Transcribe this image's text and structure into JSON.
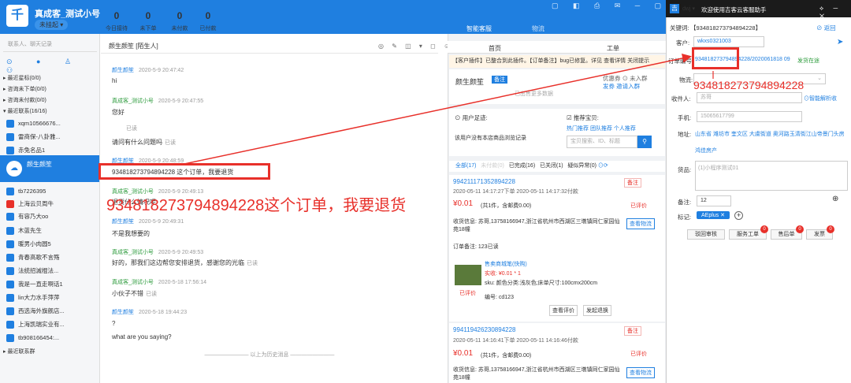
{
  "topbar": {
    "shop_name": "真成客_测试小号",
    "shop_status": "未挂起 ▾",
    "stats": [
      {
        "n": "0",
        "l": "今日接待"
      },
      {
        "n": "0",
        "l": "未下单"
      },
      {
        "n": "0",
        "l": "未付款"
      },
      {
        "n": "0",
        "l": "已付款"
      }
    ],
    "window_controls": "▢ ◧ ⎙ ✉ ─ ▢ ✕",
    "tab_smart": "智能客服",
    "tab_logistics": "物流"
  },
  "left": {
    "search_placeholder": "联系人、聊天记录",
    "filters": "⊙ ● ♙ ⚇",
    "groups": [
      "▸ 最近星标(0/0)",
      "▸ 咨询未下单(0/0)",
      "▸ 咨询未付款(0/0)",
      "▾ 最近联系(16/16)"
    ],
    "contacts": [
      "xqm10566676...",
      "雷商保-八卦雅...",
      "赤兔名品1",
      "颜生颜笙",
      "tb7226395",
      "上海云贝周牛",
      "有容乃大oo",
      "木蓝先生",
      "暖男小肉圆5",
      "青春高歌不言殇",
      "法统招滅棍法...",
      "我是一直走啊话1",
      "lin大力水手萍萍",
      "西选海外旗舰店...",
      "上海凯瑞实业有...",
      "tb908166454:..."
    ],
    "footer_group": "▸ 最近联系群"
  },
  "chat": {
    "header": "颜生颜笙 [陌生人]",
    "tools": "◎ ✎ ◫ ▾ ◻ ☺",
    "messages": [
      {
        "who": "颜生颜笙",
        "time": "2020-5-9 20:47:42",
        "text": "hi",
        "read": ""
      },
      {
        "who": "真成客_测试小号",
        "time": "2020-5-9 20:47:55",
        "text": "您好",
        "read": ""
      },
      {
        "who": "",
        "time": "",
        "text": "已读",
        "read": ""
      },
      {
        "who": "",
        "time": "",
        "text": "请问有什么问题吗",
        "read": "已读"
      },
      {
        "who": "颜生颜笙",
        "time": "2020-5-9 20:48:59",
        "text": "934818273794894228 这个订单，我要退货",
        "read": ""
      },
      {
        "who": "真成客_测试小号",
        "time": "2020-5-9 20:49:13",
        "text": "退货什么情况呢",
        "read": ""
      },
      {
        "who": "颜生颜笙",
        "time": "2020-5-9 20:49:31",
        "text": "不是我想要的",
        "read": ""
      },
      {
        "who": "真成客_测试小号",
        "time": "2020-5-9 20:49:53",
        "text": "好的，那我们这边帮您安排退货，感谢您的光临",
        "read": "已读"
      },
      {
        "who": "真成客_测试小号",
        "time": "2020-5-18 17:56:14",
        "text": "小伙子不错",
        "read": "已读"
      },
      {
        "who": "颜生颜笙",
        "time": "2020-5-18 19:44:23",
        "text": "?",
        "read": ""
      },
      {
        "who": "",
        "time": "",
        "text": "what are you saying?",
        "read": ""
      }
    ],
    "history": "———————— 以上为历史消息 ————————",
    "big_annotation": "934818273794894228这个订单，我要退货"
  },
  "orders": {
    "tab_home": "首页",
    "tab_work": "工单",
    "notice": "【客户插件】已整合到此插件。【订单备注】bug已修复。详见 查看详情 关闭提示",
    "customer_name": "颜生颜笙",
    "customer_badge": "备注",
    "customer_right1": "优惠券 ⊙  未入群",
    "customer_right2": "发券      邀请入群",
    "customer_hint": "已出售更多数据",
    "track_title": "⊙ 用户足迹:",
    "track_text": "该用户没有本店商品浏览记录",
    "rec_title": "☑ 推荐宝贝:",
    "rec_links": "热门推荐  团队推荐  个人推荐",
    "rec_placeholder": "宝贝搜索、ID、标题",
    "order_tabs": [
      "全部(17)",
      "未付款(0)",
      "已完成(16)",
      "已关闭(1)",
      "疑似异常(0)"
    ],
    "order1": {
      "id": "994211171352894228",
      "time": "2020-05-11 14:17:27下单 2020-05-11 14:17:32付款",
      "price": "¥0.01",
      "price_note": "(共1件，含邮费0.00)",
      "status": "已评价",
      "addr": "收货信息: 苏哥,13758166947,浙江省杭州市西湖区三墩镇同仁家园仙苑18幢",
      "btn_logistics": "查看物流",
      "remark": "订单备注: 123已读",
      "goods_title": "售卖商城笔(快购)",
      "goods_price": "实收: ¥0.01 * 1",
      "goods_sku": "sku: 颜色分类:浅灰色;床单尺寸:100cmx200cm",
      "goods_code": "编号: cd123",
      "goods_status": "已评价",
      "btn_review": "查看评价",
      "btn_refund": "发起退换",
      "flag": "备注"
    },
    "order2": {
      "id": "994119426230894228",
      "time": "2020-05-11 14:16:41下单 2020-05-11 14:16:46付款",
      "price": "¥0.01",
      "price_note": "(共1件，含邮费0.00)",
      "status": "已评价",
      "addr": "收货信息: 苏哥,13758166947,浙江省杭州市西湖区三墩镇同仁家园仙苑18幢",
      "btn_logistics": "查看物流",
      "flag": "备注"
    }
  },
  "assistant": {
    "user": "dwj ▾",
    "title": "欢迎使用吉客云客服助手",
    "ctrls": "⟡ ─ ✕",
    "keyword_label": "关键词:",
    "keyword_value": "【934818273794894228】",
    "back": "⊘ 返回",
    "customer_label": "客户:",
    "customer_value": "wkxs0321003",
    "order_label": "订单编号:",
    "order_value": "934818273794894228/2020061818 09",
    "order_status": "发货在途",
    "big_order": "934818273794894228",
    "logistics_label": "物流:",
    "receiver_label": "收件人:",
    "receiver_placeholder": "苏哥",
    "parse_link": "⊙智能解析收",
    "phone_label": "手机:",
    "phone_value": "15065617799",
    "address_label": "地址:",
    "address_value": "山东省 潍坊市 奎文区 大虞街道 奥河路玉清街江山帝景门头房",
    "address_value2": "鸿佳房产",
    "goods_label": "货品:",
    "goods_placeholder": "(1)小程序测试01",
    "remark_label": "备注:",
    "remark_value": "12",
    "tag_label": "标记:",
    "tag_value": "AEplus ✕",
    "buttons": [
      "驳回审核",
      "服务工单",
      "售后单",
      "发票"
    ],
    "badges": [
      "0",
      "0",
      "0"
    ]
  }
}
